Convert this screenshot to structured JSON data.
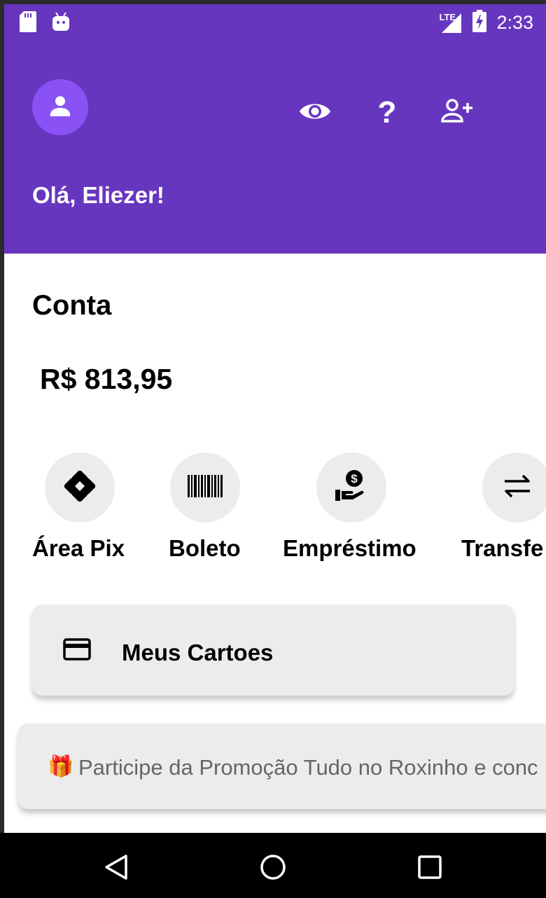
{
  "status_bar": {
    "network": "LTE",
    "time": "2:33",
    "icons": [
      "sd-card-icon",
      "android-debug-icon",
      "signal-icon",
      "battery-charging-icon"
    ]
  },
  "header": {
    "greeting": "Olá, Eliezer!",
    "icons": [
      "avatar-icon",
      "eye-icon",
      "help-icon",
      "add-person-icon"
    ]
  },
  "account": {
    "title": "Conta",
    "balance": "R$ 813,95"
  },
  "actions": [
    {
      "label": "Área Pix",
      "icon": "pix-icon"
    },
    {
      "label": "Boleto",
      "icon": "barcode-icon"
    },
    {
      "label": "Empréstimo",
      "icon": "loan-icon"
    },
    {
      "label": "Transfe",
      "icon": "transfer-icon"
    }
  ],
  "cards_button": {
    "label": "Meus Cartoes",
    "icon": "credit-card-icon"
  },
  "promo": {
    "icon": "🎁",
    "text": "Participe da Promoção Tudo no Roxinho e conc"
  },
  "nav_bar": {
    "icons": [
      "back-icon",
      "home-icon",
      "recents-icon"
    ]
  },
  "colors": {
    "header": "#6736bf",
    "avatar": "#8a52f5",
    "action_bg": "#ececec"
  }
}
